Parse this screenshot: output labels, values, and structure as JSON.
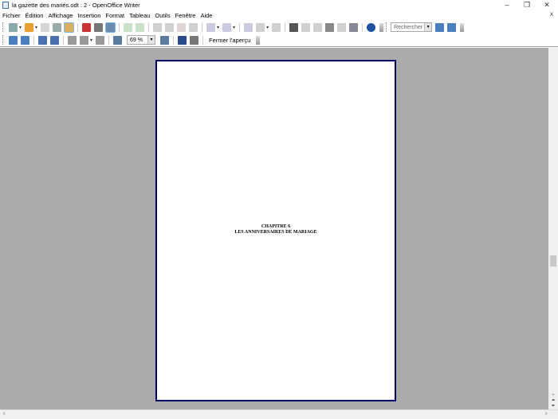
{
  "window": {
    "title": "la gazette des mariés.odt : 2 - OpenOffice Writer",
    "minimize": "–",
    "restore": "❐",
    "close": "✕",
    "doc_close": "x"
  },
  "menu": [
    "Fichier",
    "Édition",
    "Affichage",
    "Insertion",
    "Format",
    "Tableau",
    "Outils",
    "Fenêtre",
    "Aide"
  ],
  "toolbar": {
    "search_placeholder": "Rechercher"
  },
  "preview_toolbar": {
    "zoom_value": "69 %",
    "close_preview_label": "Fermer l'aperçu"
  },
  "page": {
    "lines": [
      "CHAPITRE 6",
      "LES ANNIVERSAIRES DE MARIAGE"
    ]
  },
  "colors": {
    "page_border": "#000066",
    "workspace": "#ababab"
  }
}
